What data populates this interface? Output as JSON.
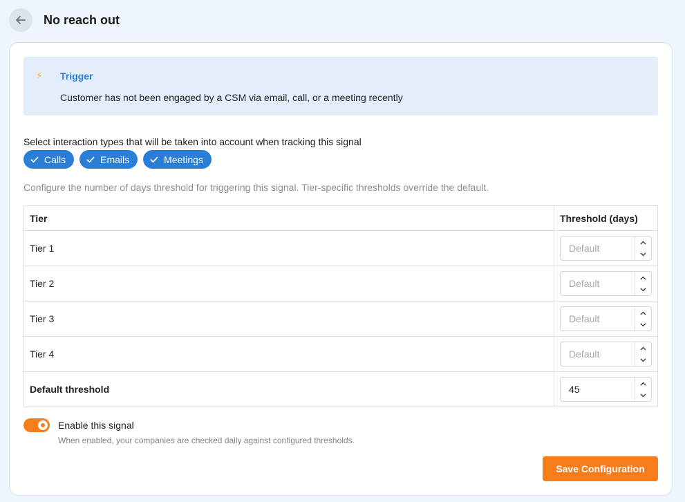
{
  "header": {
    "back_icon": "arrow-left-icon",
    "title": "No reach out"
  },
  "trigger": {
    "icon": "lightning-bolt-icon",
    "title": "Trigger",
    "description": "Customer has not been engaged by a CSM via email, call, or a meeting recently"
  },
  "interaction": {
    "label": "Select interaction types that will be taken into account when tracking this signal",
    "chips": [
      {
        "label": "Calls",
        "selected": true
      },
      {
        "label": "Emails",
        "selected": true
      },
      {
        "label": "Meetings",
        "selected": true
      }
    ]
  },
  "threshold_hint": "Configure the number of days threshold for triggering this signal. Tier-specific thresholds override the default.",
  "table": {
    "col_tier": "Tier",
    "col_threshold": "Threshold (days)",
    "rows": [
      {
        "tier": "Tier 1",
        "value": "",
        "placeholder": "Default"
      },
      {
        "tier": "Tier 2",
        "value": "",
        "placeholder": "Default"
      },
      {
        "tier": "Tier 3",
        "value": "",
        "placeholder": "Default"
      },
      {
        "tier": "Tier 4",
        "value": "",
        "placeholder": "Default"
      }
    ],
    "default_row": {
      "tier": "Default threshold",
      "value": "45"
    }
  },
  "signal": {
    "enabled": true,
    "label": "Enable this signal",
    "help": "When enabled, your companies are checked daily against configured thresholds."
  },
  "save_label": "Save Configuration",
  "colors": {
    "accent_blue": "#2a7ed8",
    "accent_orange": "#f77d1b",
    "trigger_bg": "#e3eefa"
  }
}
